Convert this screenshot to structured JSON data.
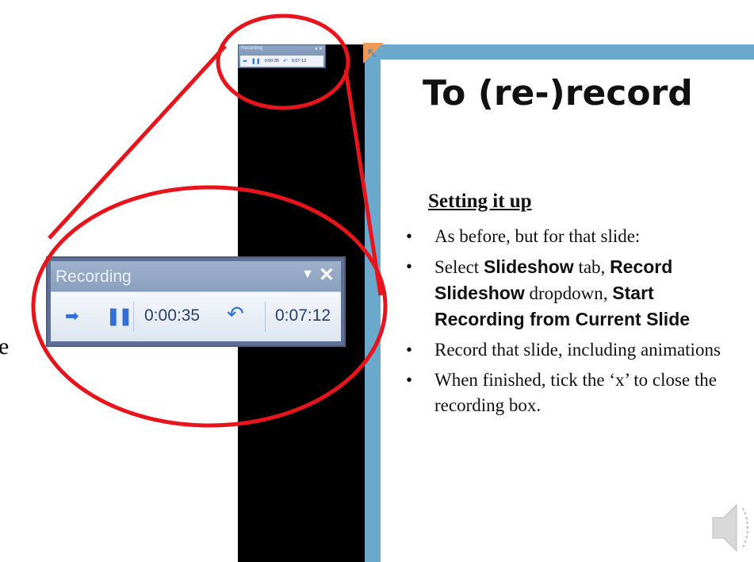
{
  "left_fragment": "e",
  "recording_toolbar": {
    "title": "Recording",
    "elapsed_slide": "0:00:35",
    "elapsed_total": "0:07:12",
    "icons": [
      "next-arrow-icon",
      "pause-icon",
      "repeat-icon",
      "dropdown-icon",
      "close-icon"
    ]
  },
  "slide": {
    "title": "To (re-)record",
    "subtitle": "Setting it up",
    "bullet1": "As before, but for that slide:",
    "bullet2_a": "Select ",
    "bullet2_b": "Slideshow",
    "bullet2_c": " tab, ",
    "bullet2_d": "Record Slideshow",
    "bullet2_e": " dropdown, ",
    "bullet2_f": "Start Recording from Current Slide",
    "bullet3": "Record that slide, including animations",
    "bullet4": "When finished, tick the ‘x’ to close the recording box."
  },
  "colors": {
    "highlight": "#e8141c",
    "slide_frame": "#6aa8cc",
    "accent_blue": "#2f6fd6"
  }
}
